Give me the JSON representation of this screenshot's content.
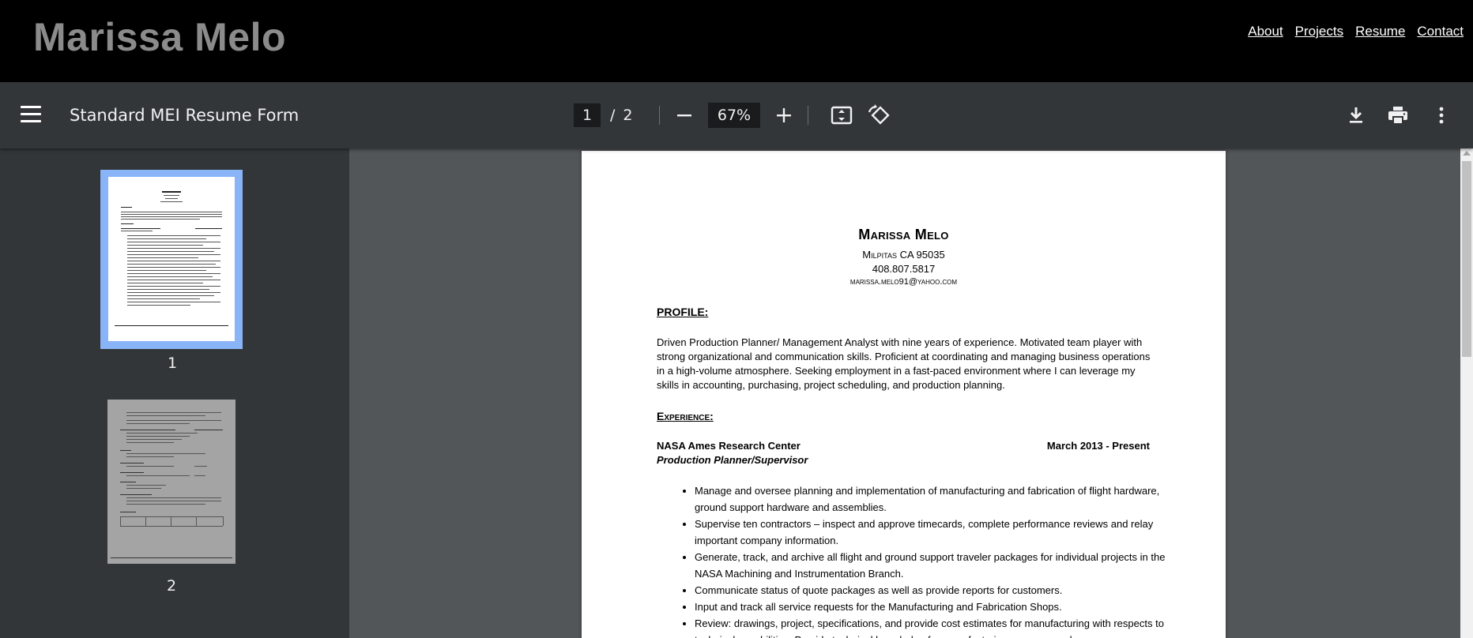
{
  "site": {
    "title": "Marissa Melo",
    "nav": [
      "About",
      "Projects",
      "Resume",
      "Contact"
    ]
  },
  "toolbar": {
    "doc_title": "Standard MEI Resume Form",
    "current_page": "1",
    "page_sep": "/",
    "total_pages": "2",
    "zoom": "67%"
  },
  "sidebar": {
    "pages": [
      "1",
      "2"
    ]
  },
  "resume": {
    "name": "Marissa Melo",
    "address": "Milpitas CA 95035",
    "phone": "408.807.5817",
    "email": "marissa.melo91@yahoo.com",
    "profile_heading": "PROFILE:",
    "profile_text": "Driven Production Planner/ Management Analyst with nine years of experience. Motivated team player with strong organizational and communication skills. Proficient at coordinating and managing business operations in a high-volume atmosphere. Seeking employment in a fast-paced environment where I can leverage my skills in accounting, purchasing, project scheduling, and production planning.",
    "experience_heading": "Experience:",
    "employer": "NASA Ames Research Center",
    "dates": "March 2013 - Present",
    "role": "Production Planner/Supervisor",
    "bullets": [
      "Manage and oversee planning and implementation of manufacturing and fabrication of flight hardware, ground support hardware and assemblies.",
      "Supervise ten contractors – inspect and approve timecards, complete performance reviews and relay important company information.",
      "Generate, track, and archive all flight and ground support traveler packages for individual projects in the NASA Machining and Instrumentation Branch.",
      "Communicate status of quote packages as well as provide reports for customers.",
      "Input and track all service requests for the Manufacturing and Fabrication Shops.",
      "Review: drawings, project, specifications, and provide cost estimates for manufacturing with respects to technical capabilities. Provide technical knowledge for manufacturing concerns and"
    ]
  },
  "colors": {
    "header_bg": "#000000",
    "toolbar_bg": "#323639",
    "viewer_bg": "#525659",
    "selected_thumb": "#8ab4f8"
  },
  "icons": [
    "menu-icon",
    "zoom-out-icon",
    "zoom-in-icon",
    "fit-page-icon",
    "rotate-icon",
    "download-icon",
    "print-icon",
    "more-icon"
  ]
}
